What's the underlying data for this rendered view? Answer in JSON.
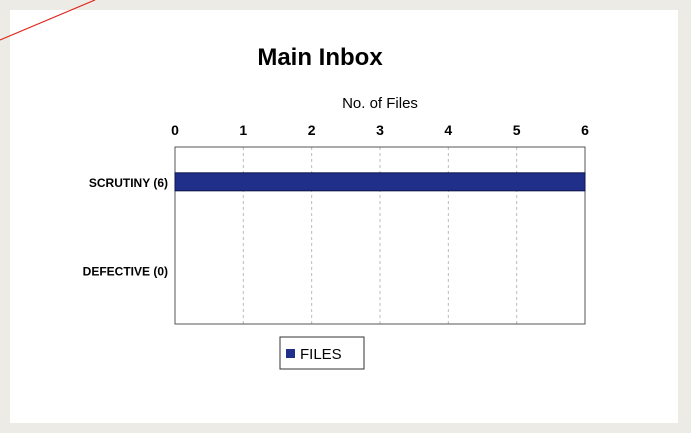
{
  "chart_data": {
    "type": "bar",
    "orientation": "horizontal",
    "title": "Main Inbox",
    "xlabel": "No. of Files",
    "ylabel": "",
    "categories": [
      "SCRUTINY (6)",
      "DEFECTIVE (0)"
    ],
    "series": [
      {
        "name": "FILES",
        "values": [
          6,
          0
        ],
        "color": "#1f2f8a"
      }
    ],
    "xlim": [
      0,
      6
    ],
    "xticks": [
      "0",
      "1",
      "2",
      "3",
      "4",
      "5",
      "6"
    ],
    "grid": true,
    "legend": "bottom"
  }
}
